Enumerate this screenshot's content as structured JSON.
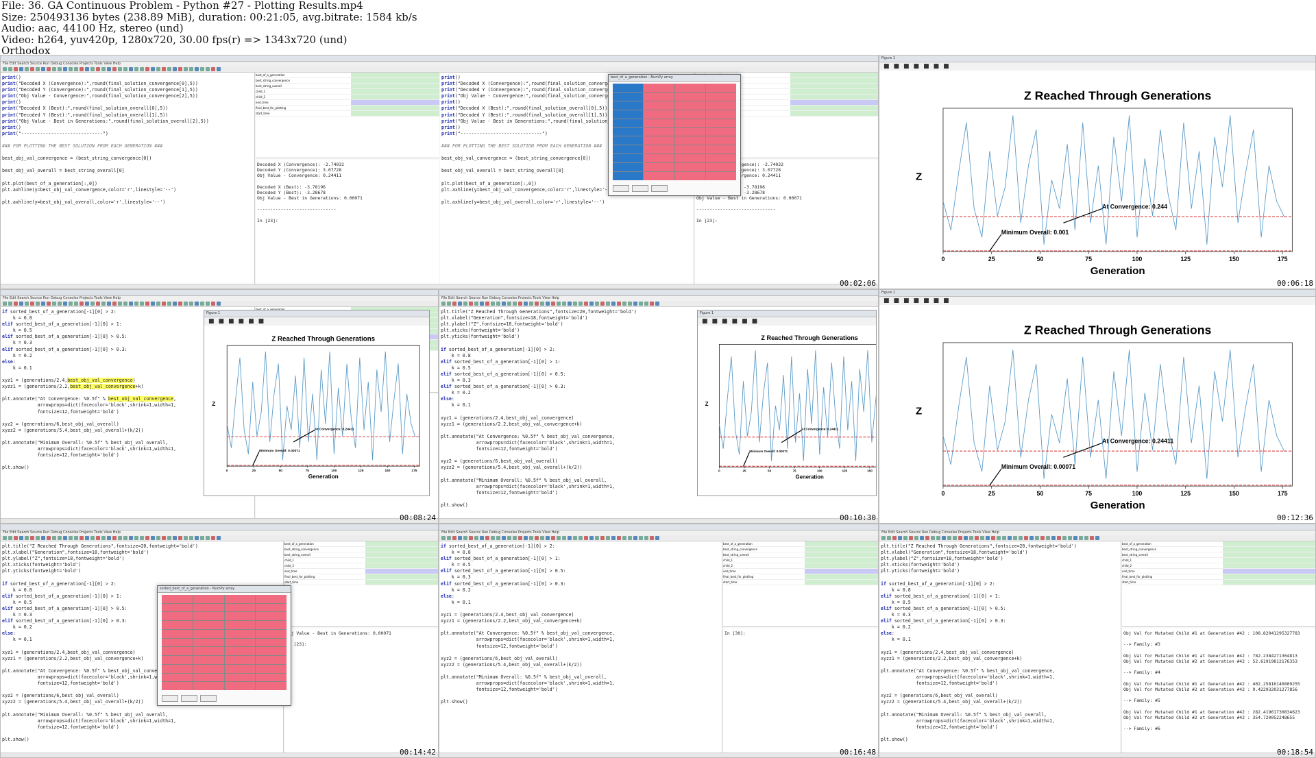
{
  "header": {
    "lines": [
      "File: 36. GA Continuous Problem - Python #27 - Plotting Results.mp4",
      "Size: 250493136 bytes (238.89 MiB), duration: 00:21:05, avg.bitrate: 1584 kb/s",
      "Audio: aac, 44100 Hz, stereo (und)",
      "Video: h264, yuv420p, 1280x720, 30.00 fps(r) => 1343x720 (und)",
      "Orthodox"
    ]
  },
  "menu_text": "File  Edit  Search  Source  Run  Debug  Consoles  Projects  Tools  View  Help",
  "timestamps": [
    "00:02:06",
    "00:04:12",
    "00:06:18",
    "00:08:24",
    "00:10:30",
    "00:12:36",
    "00:14:42",
    "00:16:48",
    "00:18:54"
  ],
  "chart": {
    "title": "Z Reached Through Generations",
    "xlabel": "Generation",
    "ylabel": "Z",
    "xticks": [
      "0",
      "25",
      "50",
      "75",
      "100",
      "125",
      "150",
      "175"
    ],
    "annot_conv_1": "At Convergence: 0.244",
    "annot_min_1": "Minimum Overall: 0.001",
    "annot_conv_2": "At Convergence: 0.24411",
    "annot_min_2": "Minimum Overall: 0.00071",
    "line_color": "#5b9bc8",
    "hline_color": "#d62728"
  },
  "chart_data": {
    "type": "line",
    "title": "Z Reached Through Generations",
    "xlabel": "Generation",
    "ylabel": "Z",
    "xlim": [
      0,
      180
    ],
    "ylim": [
      0,
      1
    ],
    "grid": false,
    "x": [
      0,
      4,
      8,
      12,
      16,
      20,
      24,
      28,
      32,
      36,
      40,
      44,
      48,
      52,
      56,
      60,
      64,
      68,
      72,
      76,
      80,
      84,
      88,
      92,
      96,
      100,
      104,
      108,
      112,
      116,
      120,
      124,
      128,
      132,
      136,
      140,
      144,
      148,
      152,
      156,
      160,
      164,
      168,
      172,
      176
    ],
    "series": [
      {
        "values": [
          0.35,
          0.15,
          0.55,
          0.9,
          0.3,
          0.1,
          0.7,
          0.25,
          0.45,
          0.95,
          0.2,
          0.6,
          0.85,
          0.05,
          0.5,
          0.3,
          0.75,
          0.15,
          0.9,
          0.2,
          0.6,
          0.05,
          0.8,
          0.35,
          0.95,
          0.1,
          0.65,
          0.25,
          0.85,
          0.4,
          0.15,
          0.9,
          0.3,
          0.7,
          0.05,
          0.8,
          0.45,
          0.95,
          0.2,
          0.55,
          0.85,
          0.1,
          0.6,
          0.35,
          0.24
        ]
      },
      {
        "values": [
          0.244,
          0.244,
          0.244,
          0.244,
          0.244,
          0.244,
          0.244,
          0.244,
          0.244,
          0.244,
          0.244,
          0.244,
          0.244,
          0.244,
          0.244,
          0.244,
          0.244,
          0.244,
          0.244,
          0.244,
          0.244,
          0.244,
          0.244,
          0.244,
          0.244,
          0.244,
          0.244,
          0.244,
          0.244,
          0.244,
          0.244,
          0.244,
          0.244,
          0.244,
          0.244,
          0.244,
          0.244,
          0.244,
          0.244,
          0.244,
          0.244,
          0.244,
          0.244,
          0.244,
          0.244
        ]
      },
      {
        "values": [
          0.001,
          0.001,
          0.001,
          0.001,
          0.001,
          0.001,
          0.001,
          0.001,
          0.001,
          0.001,
          0.001,
          0.001,
          0.001,
          0.001,
          0.001,
          0.001,
          0.001,
          0.001,
          0.001,
          0.001,
          0.001,
          0.001,
          0.001,
          0.001,
          0.001,
          0.001,
          0.001,
          0.001,
          0.001,
          0.001,
          0.001,
          0.001,
          0.001,
          0.001,
          0.001,
          0.001,
          0.001,
          0.001,
          0.001,
          0.001,
          0.001,
          0.001,
          0.001,
          0.001,
          0.001
        ]
      }
    ]
  },
  "code": {
    "a": [
      "print()",
      "print(\"Decoded X (Convergence):\",round(final_solution_convergence[0],5))",
      "print(\"Decoded Y (Convergence):\",round(final_solution_convergence[1],5))",
      "print(\"Obj Value - Convergence:\",round(final_solution_convergence[2],5))",
      "print()",
      "print(\"Decoded X (Best):\",round(final_solution_overall[0],5))",
      "print(\"Decoded Y (Best):\",round(final_solution_overall[1],5))",
      "print(\"Obj Value - Best in Generations:\",round(final_solution_overall[2],5))",
      "print()",
      "print(\"------------------------------\")",
      "",
      "### FOR PLOTTING THE BEST SOLUTION FROM EACH GENERATION ###",
      "",
      "best_obj_val_convergence = (best_string_convergence[0])",
      "",
      "best_obj_val_overall = best_string_overall[0]",
      "",
      "plt.plot(best_of_a_generation[:,0])",
      "plt.axhline(y=best_obj_val_convergence,color='r',linestyle='--')",
      "",
      "plt.axhline(y=best_obj_val_overall,color='r',linestyle='--')"
    ],
    "b": [
      "if sorted_best_of_a_generation[-1][0] > 2:",
      "    k = 0.8",
      "elif sorted_best_of_a_generation[-1][0] > 1:",
      "    k = 0.5",
      "elif sorted_best_of_a_generation[-1][0] > 0.5:",
      "    k = 0.3",
      "elif sorted_best_of_a_generation[-1][0] > 0.3:",
      "    k = 0.2",
      "else:",
      "    k = 0.1",
      "",
      "xyz1 = (generations/2.4,best_obj_val_convergence)",
      "xyzz1 = (generations/2.2,best_obj_val_convergence+k)",
      "",
      "plt.annotate(\"At Convergence: %0.5f\" % best_obj_val_convergence,",
      "             arrowprops=dict(facecolor='black',shrink=1,width=1,",
      "             fontsize=12,fontweight='bold')",
      "",
      "xyz2 = (generations/6,best_obj_val_overall)",
      "xyzz2 = (generations/5.4,best_obj_val_overall+(k/2))",
      "",
      "plt.annotate(\"Minimum Overall: %0.5f\" % best_obj_val_overall,",
      "             arrowprops=dict(facecolor='black',shrink=1,width=1,",
      "             fontsize=12,fontweight='bold')",
      "",
      "plt.show()"
    ],
    "c": [
      "plt.title(\"Z Reached Through Generations\",fontsize=20,fontweight='bold')",
      "plt.xlabel(\"Generation\",fontsize=18,fontweight='bold')",
      "plt.ylabel(\"Z\",fontsize=18,fontweight='bold')",
      "plt.xticks(fontweight='bold')",
      "plt.yticks(fontweight='bold')"
    ],
    "console": [
      "Decoded X (Convergence): -2.74032",
      "Decoded Y (Convergence): 3.07728",
      "Obj Value - Convergence: 0.24411",
      "",
      "Decoded X (Best): -3.78196",
      "Decoded Y (Best): -3.28678",
      "Obj Value - Best in Generations: 0.00071",
      "",
      "------------------------------",
      "",
      "In [23]:"
    ],
    "console2": [
      "Obj Val for Mutated Child #1 at Generation #42 : 108.82041295327783",
      "",
      "--> Family: #3",
      "",
      "Obj Val for Mutated Child #1 at Generation #42 : 782.2384271304813",
      "Obj Val for Mutated Child #2 at Generation #42 : 52.61919812176353",
      "",
      "--> Family: #4",
      "",
      "Obj Val for Mutated Child #1 at Generation #42 : 402.25816140809255",
      "Obj Val for Mutated Child #2 at Generation #42 : 9.422932031277856",
      "",
      "--> Family: #5",
      "",
      "Obj Val for Mutated Child #1 at Generation #42 : 282.41961730834623",
      "Obj Val for Mutated Child #2 at Generation #42 : 354.720052248655",
      "",
      "--> Family: #6"
    ]
  },
  "variables": [
    "best_of_a_generation",
    "best_string_convergence",
    "best_string_overall",
    "child_1",
    "child_2",
    "end_time",
    "final_best_for_plotting",
    "start_time"
  ]
}
